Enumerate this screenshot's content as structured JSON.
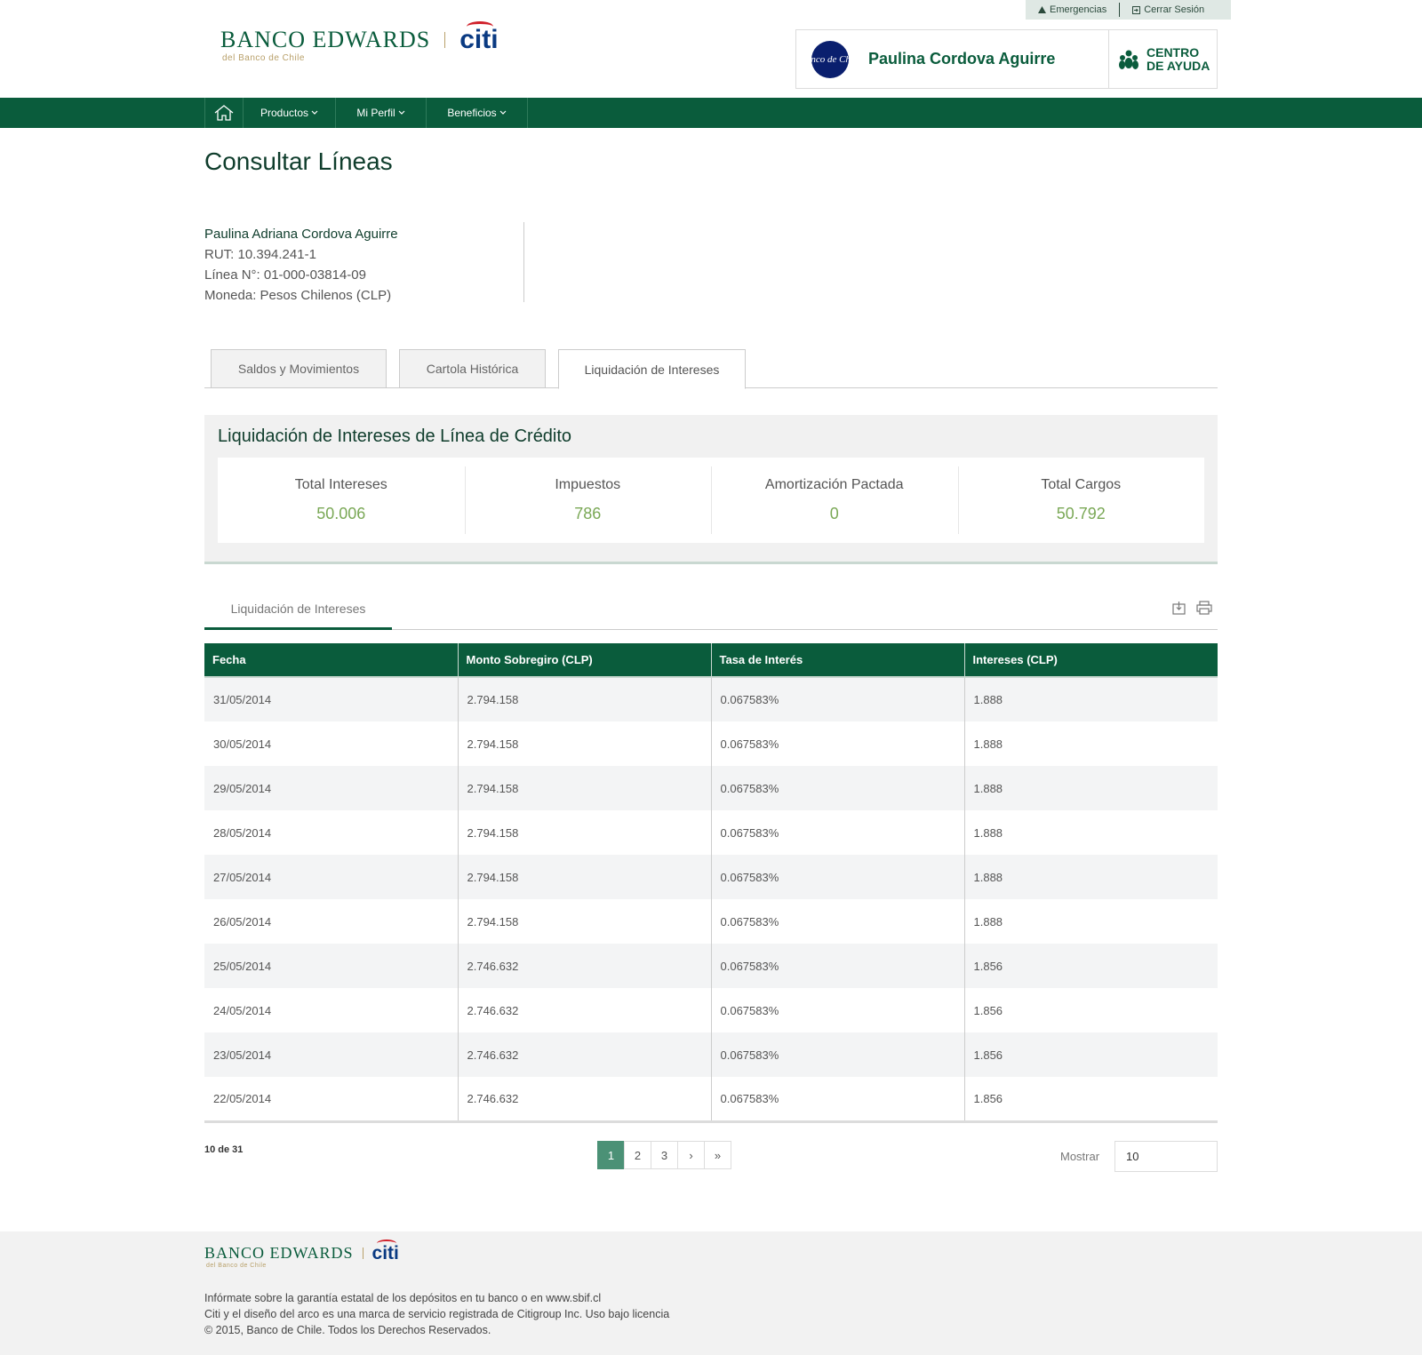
{
  "header": {
    "utility": {
      "emergencias": "Emergencias",
      "cerrar_sesion": "Cerrar Sesión"
    },
    "brand": {
      "name": "BANCO EDWARDS",
      "citi": "citi",
      "sub": "del Banco de Chile"
    },
    "user": {
      "avatar_text": "Banco de Chile",
      "name": "Paulina Cordova Aguirre"
    },
    "help": {
      "line1": "CENTRO",
      "line2": "DE AYUDA"
    }
  },
  "nav": {
    "items": [
      {
        "label": "Productos"
      },
      {
        "label": "Mi Perfil"
      },
      {
        "label": "Beneficios"
      }
    ]
  },
  "page": {
    "title": "Consultar Líneas",
    "info": {
      "name": "Paulina Adriana Cordova Aguirre",
      "rut": "RUT: 10.394.241-1",
      "linea": "Línea N°: 01-000-03814-09",
      "moneda": "Moneda: Pesos Chilenos (CLP)"
    },
    "tabs": [
      {
        "label": "Saldos y Movimientos"
      },
      {
        "label": "Cartola Histórica"
      },
      {
        "label": "Liquidación de Intereses"
      }
    ]
  },
  "summary": {
    "title": "Liquidación de Intereses de Línea de Crédito",
    "cards": [
      {
        "label": "Total Intereses",
        "value": "50.006"
      },
      {
        "label": "Impuestos",
        "value": "786"
      },
      {
        "label": "Amortización Pactada",
        "value": "0"
      },
      {
        "label": "Total Cargos",
        "value": "50.792"
      }
    ]
  },
  "subtab": {
    "label": "Liquidación de Intereses"
  },
  "table": {
    "headers": [
      "Fecha",
      "Monto Sobregiro (CLP)",
      "Tasa de Interés",
      "Intereses (CLP)"
    ],
    "rows": [
      [
        "31/05/2014",
        "2.794.158",
        "0.067583%",
        "1.888"
      ],
      [
        "30/05/2014",
        "2.794.158",
        "0.067583%",
        "1.888"
      ],
      [
        "29/05/2014",
        "2.794.158",
        "0.067583%",
        "1.888"
      ],
      [
        "28/05/2014",
        "2.794.158",
        "0.067583%",
        "1.888"
      ],
      [
        "27/05/2014",
        "2.794.158",
        "0.067583%",
        "1.888"
      ],
      [
        "26/05/2014",
        "2.794.158",
        "0.067583%",
        "1.888"
      ],
      [
        "25/05/2014",
        "2.746.632",
        "0.067583%",
        "1.856"
      ],
      [
        "24/05/2014",
        "2.746.632",
        "0.067583%",
        "1.856"
      ],
      [
        "23/05/2014",
        "2.746.632",
        "0.067583%",
        "1.856"
      ],
      [
        "22/05/2014",
        "2.746.632",
        "0.067583%",
        "1.856"
      ]
    ]
  },
  "pagination": {
    "count": "10 de 31",
    "pages": [
      "1",
      "2",
      "3",
      "›",
      "»"
    ],
    "active": "1",
    "show_label": "Mostrar",
    "show_value": "10"
  },
  "footer": {
    "brand": {
      "name": "BANCO EDWARDS",
      "citi": "citi",
      "sub": "del Banco de Chile"
    },
    "line1": "Infórmate sobre la garantía estatal de los depósitos en tu banco o en www.sbif.cl",
    "line2": "Citi y el diseño del arco es una marca de servicio registrada de Citigroup Inc. Uso bajo licencia",
    "line3": "© 2015, Banco de Chile. Todos los Derechos Reservados."
  },
  "colors": {
    "brand_green": "#0a5c3c",
    "value_green": "#7aa856",
    "citi_blue": "#0a3a82",
    "citi_red": "#d0202a",
    "gold": "#b8a06a"
  }
}
